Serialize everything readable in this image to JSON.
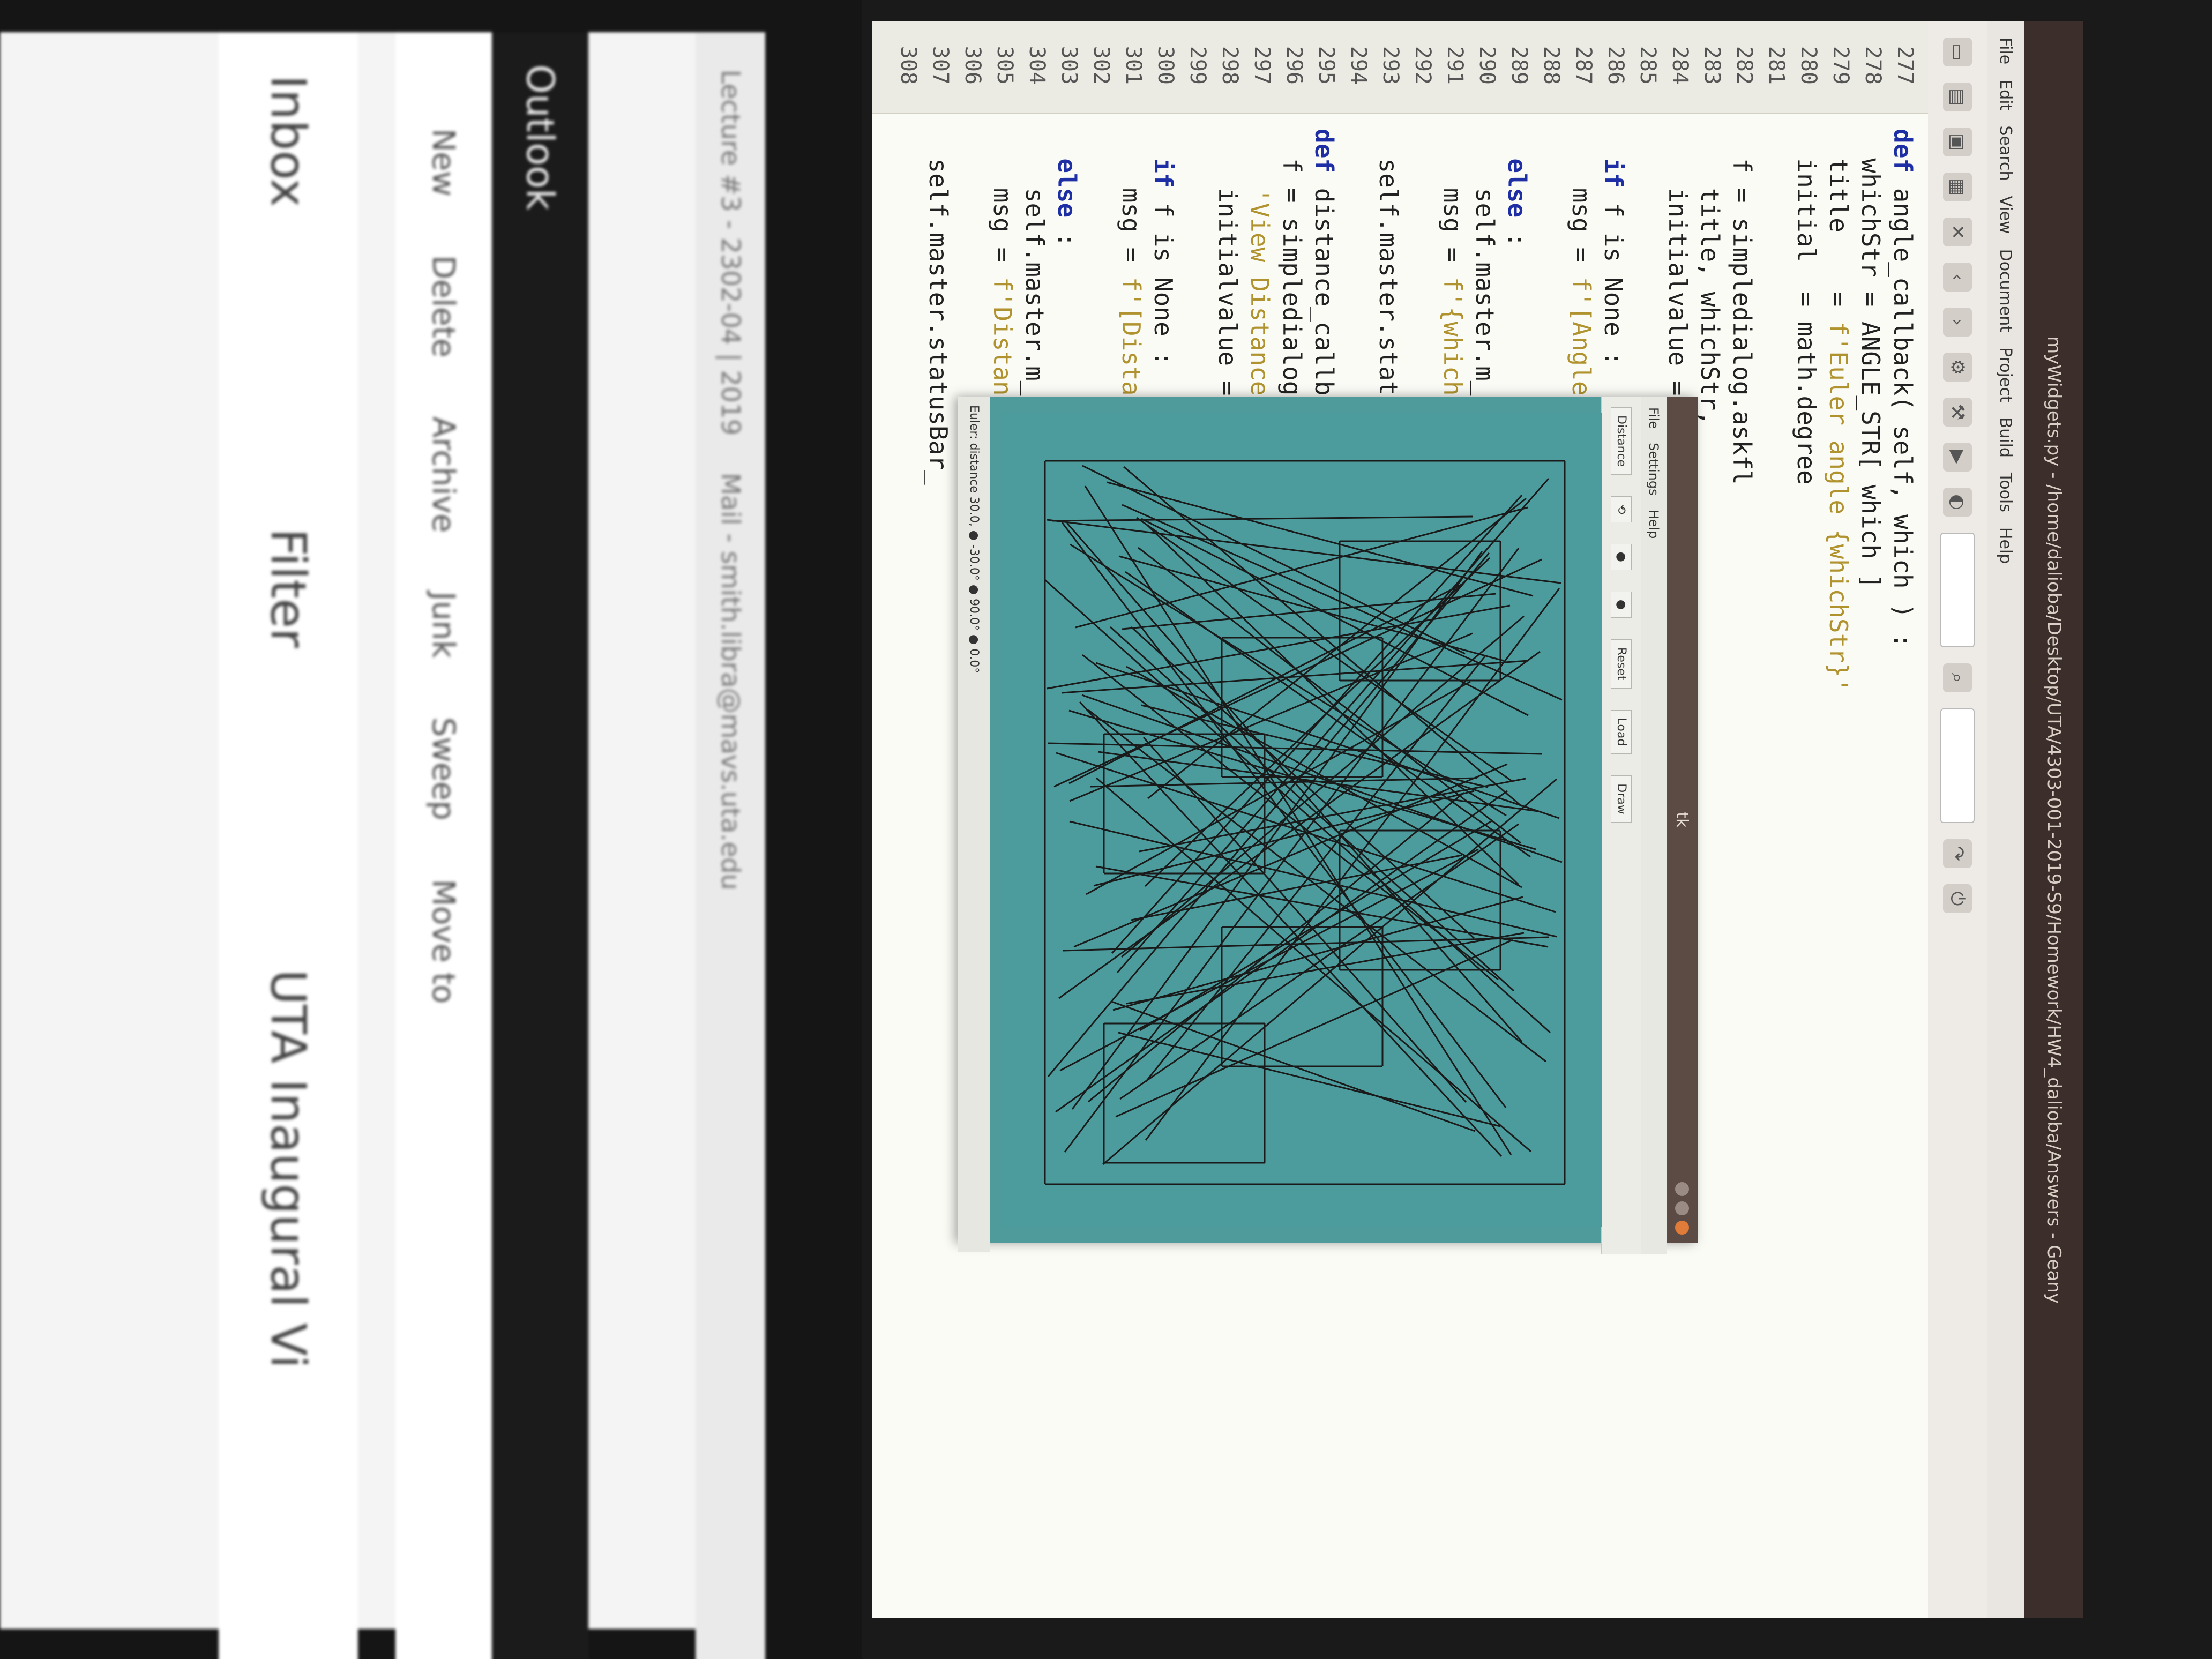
{
  "window_title": "myWidgets.py - /home/dalioba/Desktop/UTA/4303-001-2019-S9/Homework/HW4_dalioba/Answers - Geany",
  "menu": [
    "File",
    "Edit",
    "Search",
    "View",
    "Document",
    "Project",
    "Build",
    "Tools",
    "Help"
  ],
  "editor": {
    "line_numbers": [
      "277",
      "278",
      "279",
      "280",
      "281",
      "282",
      "283",
      "284",
      "285",
      "286",
      "287",
      "288",
      "289",
      "290",
      "291",
      "292",
      "293",
      "294",
      "295",
      "296",
      "297",
      "298",
      "299",
      "300",
      "301",
      "302",
      "303",
      "304",
      "305",
      "306",
      "307",
      "308"
    ],
    "code": [
      {
        "kw": "def ",
        "text": "angle_callback( self, which ) :"
      },
      {
        "text": "  whichStr = ANGLE_STR[ which ]"
      },
      {
        "text": "  title    = ",
        "str": "f'Euler angle {whichStr}'"
      },
      {
        "text": "  initial  = math.degree"
      },
      {
        "text": ""
      },
      {
        "text": "  f = simpledialog.askfl"
      },
      {
        "text": "    title, whichStr,"
      },
      {
        "text": "    initialvalue = initi"
      },
      {
        "text": ""
      },
      {
        "kw": "  if ",
        "text": "f is None :"
      },
      {
        "text": "    msg = ",
        "str": "f'[Angle was"
      },
      {
        "text": ""
      },
      {
        "kw": "  else ",
        "text": ":"
      },
      {
        "text": "    self.master.m_angl"
      },
      {
        "text": "    msg = ",
        "str": "f'{whichStr}"
      },
      {
        "text": ""
      },
      {
        "text": "  self.master.statusBar_"
      },
      {
        "text": ""
      },
      {
        "kw": "def ",
        "text": "distance_callback( s"
      },
      {
        "text": "  f = simpledialog.askfl"
      },
      {
        "text": "    ",
        "str": "'View Distance', 'Di"
      },
      {
        "text": "    initialvalue = self."
      },
      {
        "text": ""
      },
      {
        "kw": "  if ",
        "text": "f is None :"
      },
      {
        "text": "    msg = ",
        "str": "f'[Distance"
      },
      {
        "text": ""
      },
      {
        "kw": "  else ",
        "text": ":"
      },
      {
        "text": "    self.master.m_dist"
      },
      {
        "text": "    msg = ",
        "str": "f'Distance i"
      },
      {
        "text": ""
      },
      {
        "text": "  self.master.statusBar_"
      },
      {
        "text": ""
      }
    ]
  },
  "tk_window": {
    "title": "tk",
    "menu": [
      "File",
      "Settings",
      "Help"
    ],
    "tools": [
      "Distance",
      "Reset",
      "Load",
      "Draw"
    ],
    "status": "Euler: distance 30.0, ● -30.0° ● 90.0° ● 0.0°"
  },
  "outlook": {
    "tabs": [
      "Lecture #3 - 2302-04 | 2019",
      "Mail - smith.libra@mavs.uta.edu"
    ],
    "brand": "Outlook",
    "actions": [
      "New",
      "Delete",
      "Archive",
      "Junk",
      "Sweep",
      "Move to"
    ],
    "inbox": "Inbox",
    "filter": "Filter",
    "preview": "UTA Inaugural Vi"
  }
}
